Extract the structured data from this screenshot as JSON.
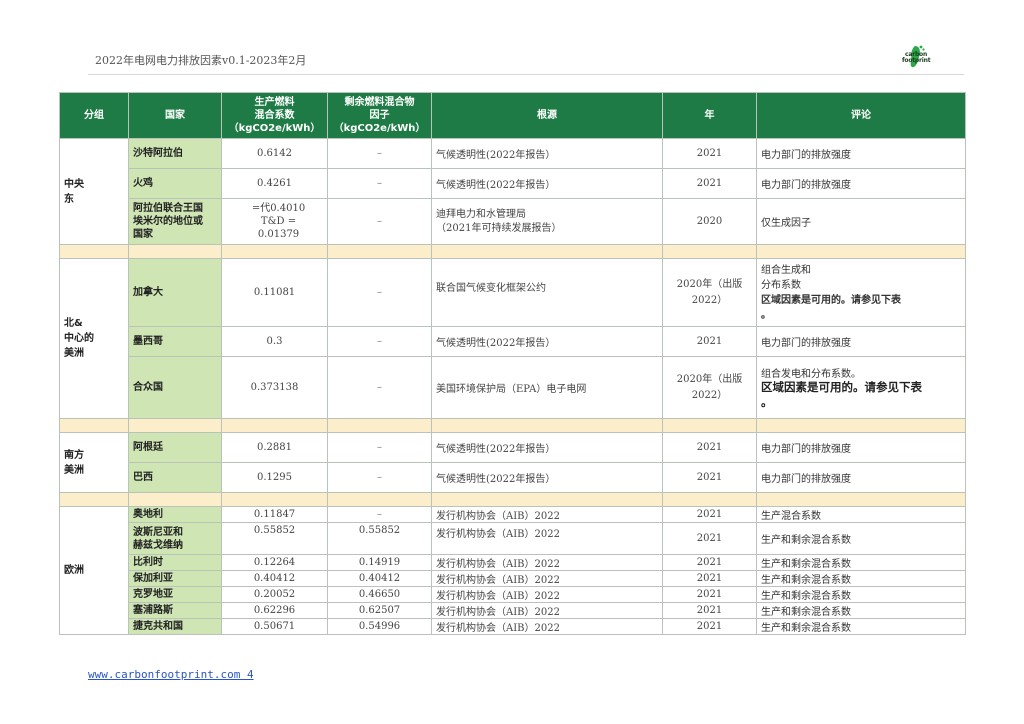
{
  "header": {
    "title": "2022年电网电力排放因素v0.1-2023年2月"
  },
  "logo": {
    "line1": "carbon",
    "line2": "footprint",
    "icon": "footprint-icon",
    "color": "#2aa84a"
  },
  "footer": {
    "text": "www.carbonfootprint.com 4"
  },
  "colors": {
    "header_green": "#1e7b45",
    "country_green": "#cfe6b4",
    "separator": "#fdeecb"
  },
  "table": {
    "headers": {
      "group": "分组",
      "country": "国家",
      "prod_l1": "生产燃料",
      "prod_l2": "混合系数",
      "prod_l3": "（kgCO2e/kWh）",
      "res_l1": "剩余燃料混合物",
      "res_l2": "因子",
      "res_l3": "（kgCO2e/kWh）",
      "source": "根源",
      "year": "年",
      "comment": "评论"
    },
    "groups": {
      "middle_east_l1": "中央",
      "middle_east_l2": "东",
      "north_central_l1": "北&",
      "north_central_l2": "中心的",
      "north_central_l3": "美洲",
      "south_america_l1": "南方",
      "south_america_l2": "美洲",
      "europe": "欧洲"
    },
    "rows": {
      "saudi": {
        "country": "沙特阿拉伯",
        "prod": "0.6142",
        "res": "–",
        "source": "气候透明性(2022年报告）",
        "year": "2021",
        "comment": "电力部门的排放强度"
      },
      "turkey": {
        "country": "火鸡",
        "prod": "0.4261",
        "res": "–",
        "source": "气候透明性(2022年报告）",
        "year": "2021",
        "comment": "电力部门的排放强度"
      },
      "uae": {
        "country_l1": "阿拉伯联合王国",
        "country_l2": "埃米尔的地位或",
        "country_l3": "国家",
        "prod_l1": "=代0.4010",
        "prod_l2": "T&D =",
        "prod_l3": "0.01379",
        "res": "–",
        "source_l1": "迪拜电力和水管理局",
        "source_l2": "（2021年可持续发展报告）",
        "year": "2020",
        "comment": "仅生成因子"
      },
      "canada": {
        "country": "加拿大",
        "prod": "0.11081",
        "res": "–",
        "source": "联合国气候变化框架公约",
        "year_l1": "2020年（出版",
        "year_l2": "2022）",
        "comment_l1": "组合生成和",
        "comment_l2": "分布系数",
        "comment_l3": "区域因素是可用的。请参见下表",
        "comment_l4": "。"
      },
      "mexico": {
        "country": "墨西哥",
        "prod": "0.3",
        "res": "–",
        "source": "气候透明性(2022年报告）",
        "year": "2021",
        "comment": "电力部门的排放强度"
      },
      "usa": {
        "country": "合众国",
        "prod": "0.373138",
        "res": "–",
        "source": "美国环境保护局（EPA）电子电网",
        "year_l1": "2020年（出版",
        "year_l2": "2022）",
        "comment_l1": "组合发电和分布系数。",
        "comment_l2": "区域因素是可用的。请参见下表",
        "comment_l3": "。"
      },
      "argentina": {
        "country": "阿根廷",
        "prod": "0.2881",
        "res": "–",
        "source": "气候透明性(2022年报告）",
        "year": "2021",
        "comment": "电力部门的排放强度"
      },
      "brazil": {
        "country": "巴西",
        "prod": "0.1295",
        "res": "–",
        "source": "气候透明性(2022年报告）",
        "year": "2021",
        "comment": "电力部门的排放强度"
      },
      "austria": {
        "country": "奥地利",
        "prod": "0.11847",
        "res": "–",
        "source": "发行机构协会（AIB）2022",
        "year": "2021",
        "comment": "生产混合系数"
      },
      "bosnia": {
        "country_l1": "波斯尼亚和",
        "country_l2": "赫兹戈维纳",
        "prod": "0.55852",
        "res": "0.55852",
        "source": "发行机构协会（AIB）2022",
        "year": "2021",
        "comment": "生产和剩余混合系数"
      },
      "belgium": {
        "country": "比利时",
        "prod": "0.12264",
        "res": "0.14919",
        "source": "发行机构协会（AIB）2022",
        "year": "2021",
        "comment": "生产和剩余混合系数"
      },
      "bulgaria": {
        "country": "保加利亚",
        "prod": "0.40412",
        "res": "0.40412",
        "source": "发行机构协会（AIB）2022",
        "year": "2021",
        "comment": "生产和剩余混合系数"
      },
      "croatia": {
        "country": "克罗地亚",
        "prod": "0.20052",
        "res": "0.46650",
        "source": "发行机构协会（AIB）2022",
        "year": "2021",
        "comment": "生产和剩余混合系数"
      },
      "cyprus": {
        "country": "塞浦路斯",
        "prod": "0.62296",
        "res": "0.62507",
        "source": "发行机构协会（AIB）2022",
        "year": "2021",
        "comment": "生产和剩余混合系数"
      },
      "czech": {
        "country": "捷克共和国",
        "prod": "0.50671",
        "res": "0.54996",
        "source": "发行机构协会（AIB）2022",
        "year": "2021",
        "comment": "生产和剩余混合系数"
      }
    }
  }
}
